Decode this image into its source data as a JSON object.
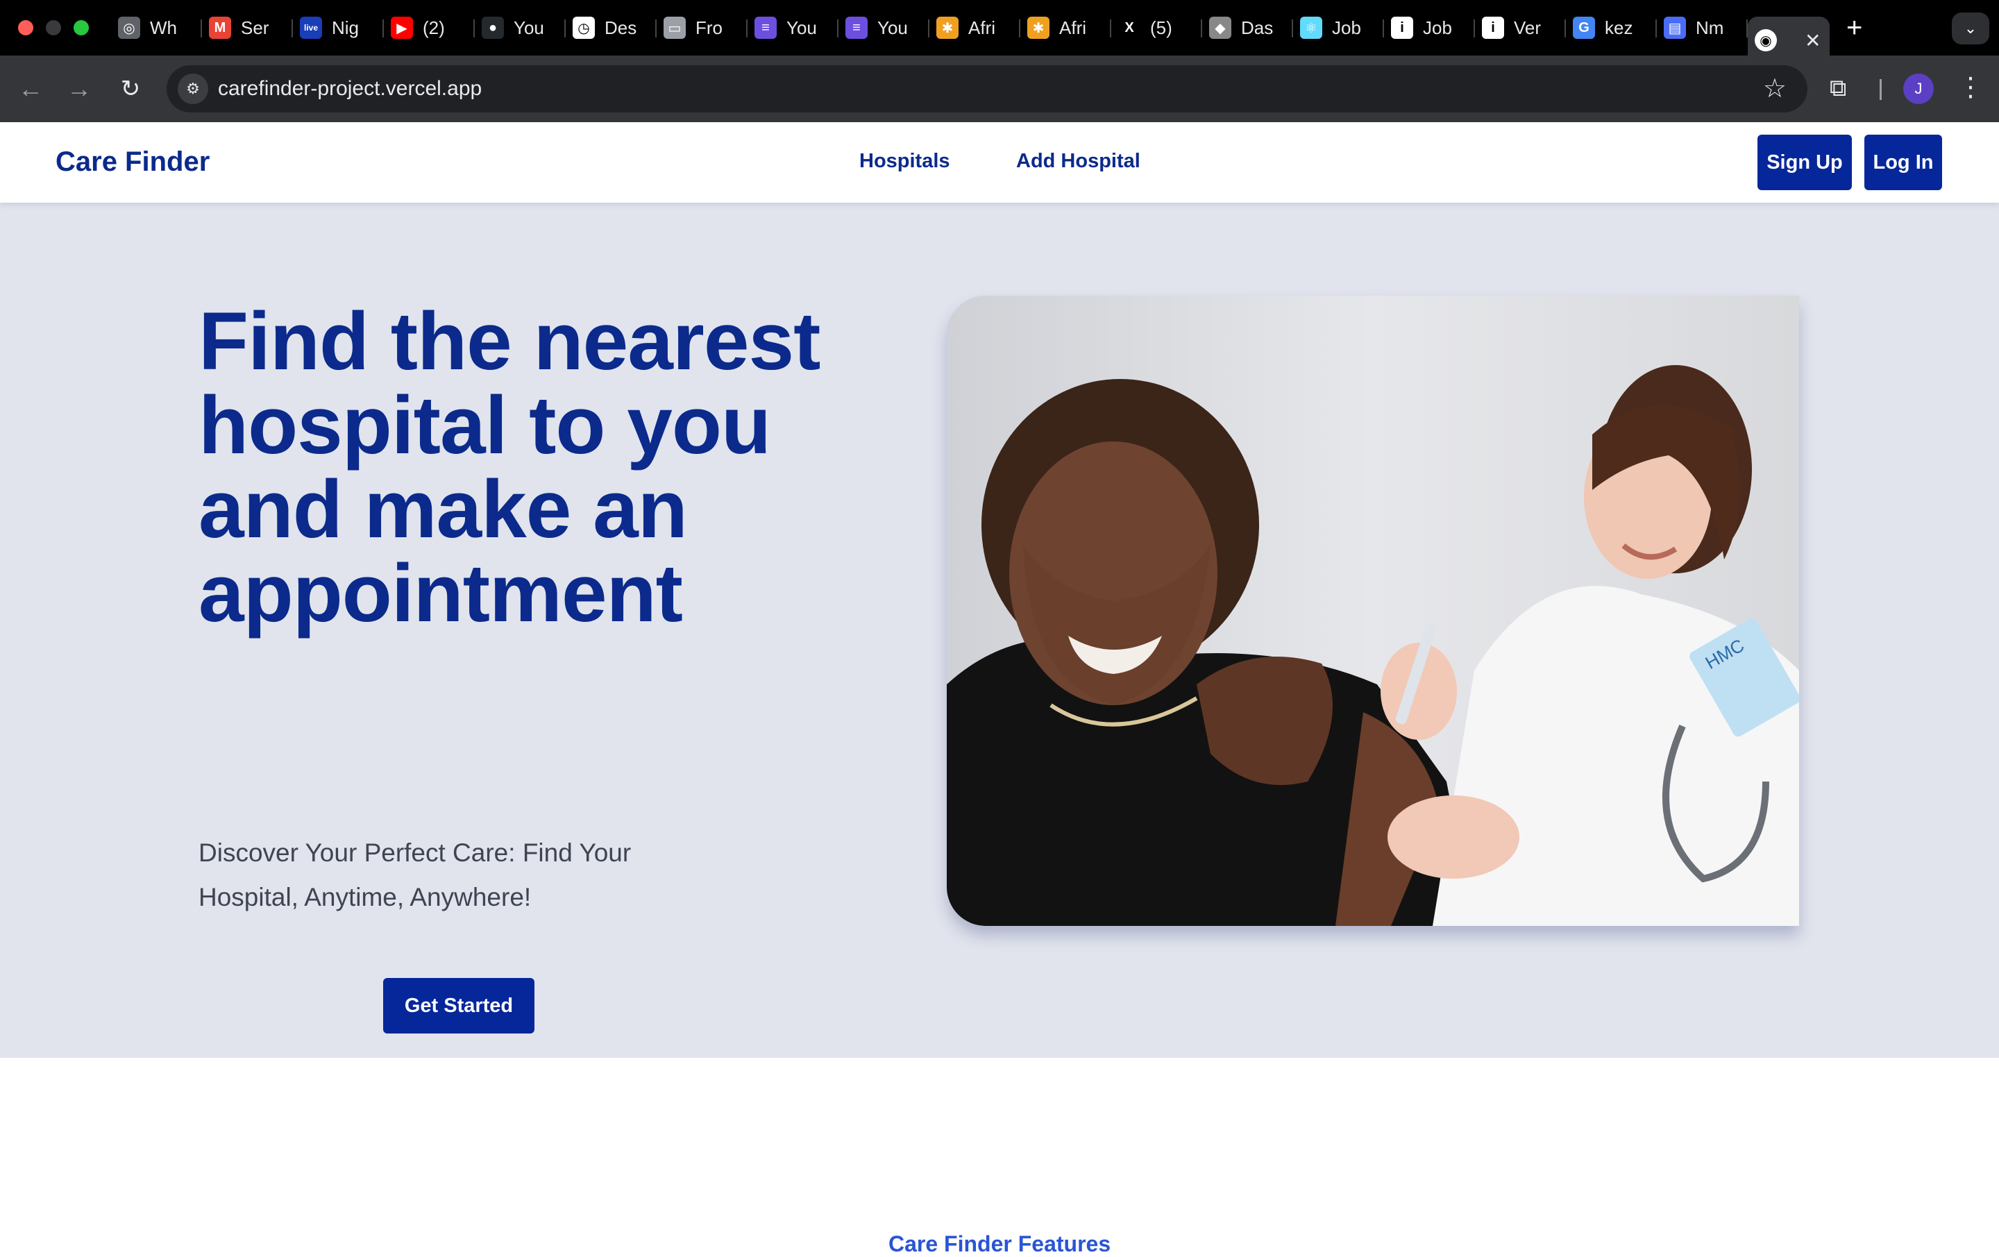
{
  "browser": {
    "tabs": [
      {
        "title": "Wh",
        "icon": "chrome-icon",
        "color": "#5f6368",
        "glyph": "◎"
      },
      {
        "title": "Ser",
        "icon": "gmail-icon",
        "color": "#ea4335",
        "glyph": "M"
      },
      {
        "title": "Nig",
        "icon": "live-icon",
        "color": "#1a3db8",
        "glyph": "live"
      },
      {
        "title": "(2)",
        "icon": "youtube-icon",
        "color": "#ff0000",
        "glyph": "▶"
      },
      {
        "title": "You",
        "icon": "github-icon",
        "color": "#24292e",
        "glyph": "●"
      },
      {
        "title": "Des",
        "icon": "timer-icon",
        "color": "#ffffff",
        "glyph": "◷"
      },
      {
        "title": "Fro",
        "icon": "monitor-icon",
        "color": "#9aa0a6",
        "glyph": "▭"
      },
      {
        "title": "You",
        "icon": "list-icon",
        "color": "#6d4fe0",
        "glyph": "≡"
      },
      {
        "title": "You",
        "icon": "list-icon",
        "color": "#6d4fe0",
        "glyph": "≡"
      },
      {
        "title": "Afri",
        "icon": "sun-icon",
        "color": "#f0a020",
        "glyph": "✱"
      },
      {
        "title": "Afri",
        "icon": "sun-icon",
        "color": "#f0a020",
        "glyph": "✱"
      },
      {
        "title": "(5)",
        "icon": "x-icon",
        "color": "#000000",
        "glyph": "X"
      },
      {
        "title": "Das",
        "icon": "app-icon",
        "color": "#888888",
        "glyph": "◆"
      },
      {
        "title": "Job",
        "icon": "react-icon",
        "color": "#61dafb",
        "glyph": "⚛"
      },
      {
        "title": "Job",
        "icon": "info-icon",
        "color": "#ffffff",
        "glyph": "i"
      },
      {
        "title": "Ver",
        "icon": "info-icon",
        "color": "#ffffff",
        "glyph": "i"
      },
      {
        "title": "kez",
        "icon": "google-icon",
        "color": "#4285f4",
        "glyph": "G"
      },
      {
        "title": "Nm",
        "icon": "doc-icon",
        "color": "#4a6cf7",
        "glyph": "▤"
      }
    ],
    "url": "carefinder-project.vercel.app",
    "profile_initial": "J"
  },
  "site": {
    "brand": "Care Finder",
    "nav": {
      "hospitals": "Hospitals",
      "add_hospital": "Add Hospital"
    },
    "auth": {
      "sign_up": "Sign Up",
      "log_in": "Log In"
    }
  },
  "hero": {
    "headline": "Find the nearest hospital to you and make an appointment",
    "subtitle": "Discover Your Perfect Care: Find Your Hospital, Anytime, Anywhere!",
    "cta": "Get Started",
    "image_badge": "HMC"
  },
  "next_section": {
    "title": "Care Finder Features"
  },
  "colors": {
    "brand_blue": "#0b2a8c",
    "button_blue": "#06279a",
    "hero_bg": "#e1e4ed"
  }
}
